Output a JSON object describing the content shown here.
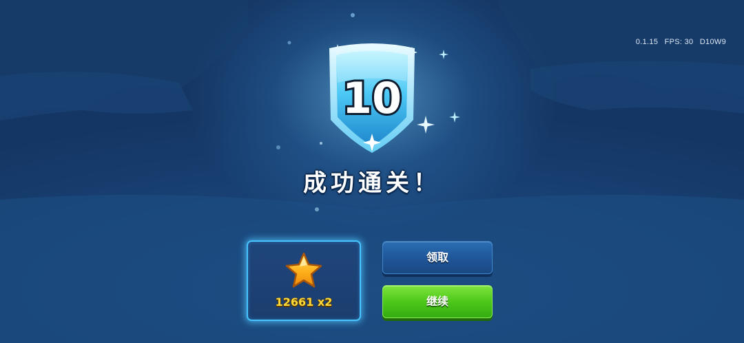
{
  "version_info": {
    "version": "0.1.15",
    "fps": "FPS: 30",
    "build": "D10W9"
  },
  "badge": {
    "level": "10",
    "colors": {
      "light": "#8fe6ff",
      "mid": "#38b9f0",
      "dark": "#1671b8"
    }
  },
  "result": {
    "title": "成功通关！"
  },
  "reward": {
    "icon": "star-icon",
    "amount": "12661 x2"
  },
  "buttons": {
    "claim_label": "领取",
    "continue_label": "继续"
  },
  "colors": {
    "reward_amount": "#ffd93a",
    "continue_button": "#4dc81a",
    "claim_button": "#1f5597"
  }
}
